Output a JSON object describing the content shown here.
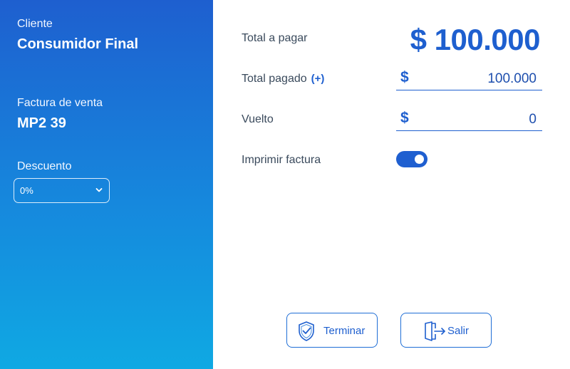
{
  "client": {
    "label": "Cliente",
    "name": "Consumidor Final"
  },
  "invoice": {
    "label": "Factura de venta",
    "number": "MP2 39"
  },
  "discount": {
    "label": "Descuento",
    "selected": "0%"
  },
  "payment": {
    "total_label": "Total a pagar",
    "total_amount": "$ 100.000",
    "paid_label": "Total pagado",
    "paid_add": "(+)",
    "paid_currency": "$",
    "paid_amount": "100.000",
    "change_label": "Vuelto",
    "change_currency": "$",
    "change_amount": "0",
    "print_label": "Imprimir factura",
    "print_enabled": true
  },
  "actions": {
    "finish_label": "Terminar",
    "exit_label": "Salir"
  },
  "colors": {
    "accent": "#1e5fcf",
    "panel_top": "#1e5fcf",
    "panel_bottom": "#0fa9e3"
  },
  "icons": {
    "discount_chevron": "chevron-down-icon",
    "finish": "shield-check-icon",
    "exit": "door-exit-icon"
  }
}
